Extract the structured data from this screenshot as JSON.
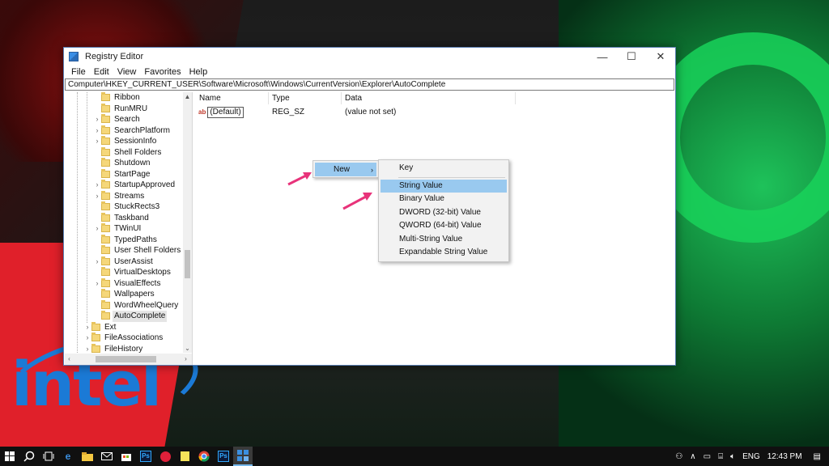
{
  "window": {
    "title": "Registry Editor",
    "minimize": "—",
    "maximize": "☐",
    "close": "✕"
  },
  "menu": [
    "File",
    "Edit",
    "View",
    "Favorites",
    "Help"
  ],
  "address": "Computer\\HKEY_CURRENT_USER\\Software\\Microsoft\\Windows\\CurrentVersion\\Explorer\\AutoComplete",
  "tree": [
    {
      "label": "Ribbon",
      "expander": ""
    },
    {
      "label": "RunMRU",
      "expander": ""
    },
    {
      "label": "Search",
      "expander": "›"
    },
    {
      "label": "SearchPlatform",
      "expander": "›"
    },
    {
      "label": "SessionInfo",
      "expander": "›"
    },
    {
      "label": "Shell Folders",
      "expander": ""
    },
    {
      "label": "Shutdown",
      "expander": ""
    },
    {
      "label": "StartPage",
      "expander": ""
    },
    {
      "label": "StartupApproved",
      "expander": "›"
    },
    {
      "label": "Streams",
      "expander": "›"
    },
    {
      "label": "StuckRects3",
      "expander": ""
    },
    {
      "label": "Taskband",
      "expander": ""
    },
    {
      "label": "TWinUI",
      "expander": "›"
    },
    {
      "label": "TypedPaths",
      "expander": ""
    },
    {
      "label": "User Shell Folders",
      "expander": ""
    },
    {
      "label": "UserAssist",
      "expander": "›"
    },
    {
      "label": "VirtualDesktops",
      "expander": ""
    },
    {
      "label": "VisualEffects",
      "expander": "›"
    },
    {
      "label": "Wallpapers",
      "expander": ""
    },
    {
      "label": "WordWheelQuery",
      "expander": ""
    },
    {
      "label": "AutoComplete",
      "expander": "",
      "selected": true
    },
    {
      "label": "Ext",
      "expander": "›",
      "level": 0
    },
    {
      "label": "FileAssociations",
      "expander": "›",
      "level": 0
    },
    {
      "label": "FileHistory",
      "expander": "›",
      "level": 0
    }
  ],
  "columns": {
    "name": "Name",
    "type": "Type",
    "data": "Data"
  },
  "values": [
    {
      "icon": "ab",
      "name": "(Default)",
      "type": "REG_SZ",
      "data": "(value not set)"
    }
  ],
  "context_menu": {
    "new_label": "New",
    "submenu": {
      "key": "Key",
      "items": [
        "String Value",
        "Binary Value",
        "DWORD (32-bit) Value",
        "QWORD (64-bit) Value",
        "Multi-String Value",
        "Expandable String Value"
      ],
      "highlighted_index": 0
    }
  },
  "wallpaper": {
    "logo_text": "intel"
  },
  "taskbar": {
    "clock": "12:43 PM",
    "language": "ENG",
    "icons": [
      "windows-start-icon",
      "search-icon",
      "task-view-icon",
      "edge-icon",
      "file-explorer-icon",
      "mail-icon",
      "store-icon",
      "photoshop-icon",
      "app-icon",
      "sticky-notes-icon",
      "chrome-icon",
      "photoshop-icon",
      "registry-editor-icon"
    ]
  },
  "colors": {
    "highlight": "#99c9ef",
    "arrow": "#e8337a",
    "taskbar": "#101010"
  }
}
